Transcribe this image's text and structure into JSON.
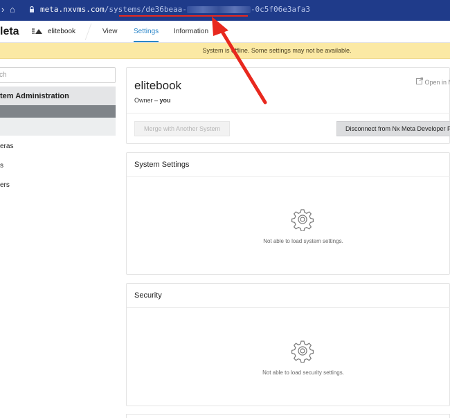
{
  "browser": {
    "back_icon": "›",
    "home_icon": "⌂",
    "lock_icon": "🔒",
    "url_host": "meta.nxvms.com",
    "url_path": "/systems/",
    "url_id_start": "de36beaa-",
    "url_id_end": "-0c5f06e3afa3"
  },
  "header": {
    "brand": "leta",
    "system_name": "elitebook",
    "tabs": [
      {
        "label": "View"
      },
      {
        "label": "Settings"
      },
      {
        "label": "Information"
      }
    ]
  },
  "banner": {
    "text": "System is offline. Some settings may not be available."
  },
  "sidebar": {
    "search_placeholder": "ch",
    "section_label": "tem Administration",
    "items": [
      {
        "label": "eras"
      },
      {
        "label": "s"
      },
      {
        "label": "ers"
      }
    ]
  },
  "system_card": {
    "title": "elitebook",
    "owner_label": "Owner –",
    "owner_value": "you",
    "open_link": "Open in N",
    "merge_button": "Merge with Another System",
    "disconnect_button": "Disconnect from Nx Meta Developer P"
  },
  "settings_card": {
    "title": "System Settings",
    "empty_text": "Not able to load system settings."
  },
  "security_card": {
    "title": "Security",
    "empty_text": "Not able to load security settings."
  },
  "colors": {
    "browser_bar": "#1f3b8a",
    "accent": "#2a86c9",
    "banner": "#fbe9a4",
    "annotation": "#e8281e"
  }
}
